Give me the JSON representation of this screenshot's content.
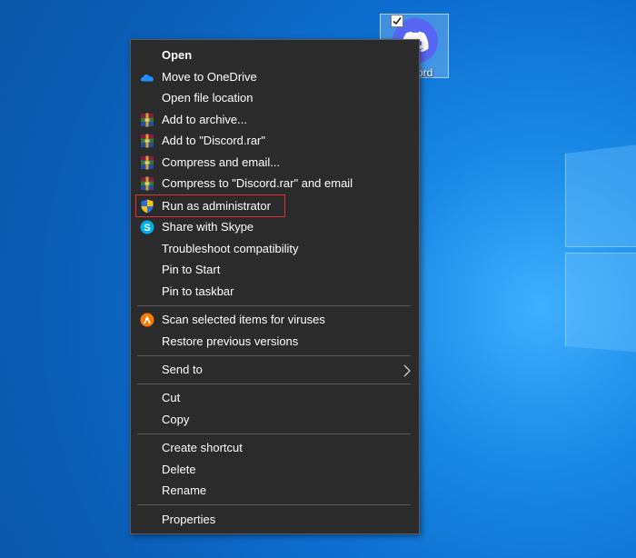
{
  "desktop": {
    "icon_label": "Discord"
  },
  "context_menu": {
    "items": [
      {
        "label": "Open",
        "icon": "none"
      },
      {
        "label": "Move to OneDrive",
        "icon": "onedrive-icon"
      },
      {
        "label": "Open file location",
        "icon": "none"
      },
      {
        "label": "Add to archive...",
        "icon": "winrar-icon"
      },
      {
        "label": "Add to \"Discord.rar\"",
        "icon": "winrar-icon"
      },
      {
        "label": "Compress and email...",
        "icon": "winrar-icon"
      },
      {
        "label": "Compress to \"Discord.rar\" and email",
        "icon": "winrar-icon"
      },
      {
        "label": "Run as administrator",
        "icon": "uac-shield-icon"
      },
      {
        "label": "Share with Skype",
        "icon": "skype-icon"
      },
      {
        "label": "Troubleshoot compatibility",
        "icon": "none"
      },
      {
        "label": "Pin to Start",
        "icon": "none"
      },
      {
        "label": "Pin to taskbar",
        "icon": "none"
      },
      {
        "label": "Scan selected items for viruses",
        "icon": "avast-icon"
      },
      {
        "label": "Restore previous versions",
        "icon": "none"
      },
      {
        "label": "Send to",
        "icon": "chevron-right-icon"
      },
      {
        "label": "Cut",
        "icon": "none"
      },
      {
        "label": "Copy",
        "icon": "none"
      },
      {
        "label": "Create shortcut",
        "icon": "none"
      },
      {
        "label": "Delete",
        "icon": "none"
      },
      {
        "label": "Rename",
        "icon": "none"
      },
      {
        "label": "Properties",
        "icon": "none"
      }
    ],
    "highlighted_item": "Run as administrator"
  },
  "colors": {
    "menu_background": "#2b2b2b",
    "menu_text": "#ffffff",
    "highlight_border": "#e0323a",
    "discord_blurple": "#5865f2"
  }
}
